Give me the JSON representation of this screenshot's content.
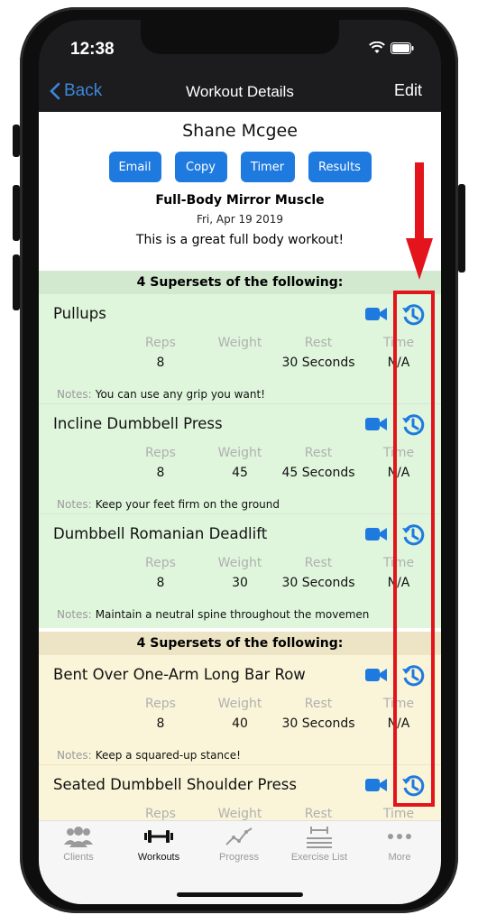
{
  "status_bar": {
    "time": "12:38"
  },
  "nav": {
    "back_label": "Back",
    "title": "Workout Details",
    "edit_label": "Edit"
  },
  "header": {
    "client_name": "Shane Mcgee",
    "buttons": [
      "Email",
      "Copy",
      "Timer",
      "Results"
    ],
    "workout_name": "Full-Body Mirror Muscle",
    "date": "Fri, Apr 19 2019",
    "description": "This is a great full body workout!"
  },
  "sections": [
    {
      "title": "4 Supersets of the following:",
      "color": "#dff6dc",
      "exercises": [
        {
          "name": "Pullups",
          "reps": "8",
          "weight": "",
          "rest": "30 Seconds",
          "time": "N/A",
          "notes": "You can use any grip you want!"
        },
        {
          "name": "Incline Dumbbell Press",
          "reps": "8",
          "weight": "45",
          "rest": "45 Seconds",
          "time": "N/A",
          "notes": "Keep your feet firm on the ground"
        },
        {
          "name": "Dumbbell Romanian Deadlift",
          "reps": "8",
          "weight": "30",
          "rest": "30 Seconds",
          "time": "N/A",
          "notes": "Maintain a neutral spine throughout the movemen"
        }
      ]
    },
    {
      "title": "4 Supersets of the following:",
      "color": "#faf5d8",
      "exercises": [
        {
          "name": "Bent Over One-Arm Long Bar Row",
          "reps": "8",
          "weight": "40",
          "rest": "30 Seconds",
          "time": "N/A",
          "notes": "Keep a squared-up stance!"
        },
        {
          "name": "Seated Dumbbell Shoulder Press",
          "reps": "",
          "weight": "",
          "rest": "",
          "time": "",
          "notes": ""
        }
      ]
    }
  ],
  "columns": {
    "reps": "Reps",
    "weight": "Weight",
    "rest": "Rest",
    "time": "Time"
  },
  "notes_label": "Notes:",
  "tabs": [
    {
      "label": "Clients",
      "icon": "clients-icon"
    },
    {
      "label": "Workouts",
      "icon": "dumbbell-icon"
    },
    {
      "label": "Progress",
      "icon": "progress-chart-icon"
    },
    {
      "label": "Exercise List",
      "icon": "exercise-list-icon"
    },
    {
      "label": "More",
      "icon": "more-dots-icon"
    }
  ],
  "colors": {
    "accent": "#1f7ae0",
    "highlight": "#e3141c"
  }
}
